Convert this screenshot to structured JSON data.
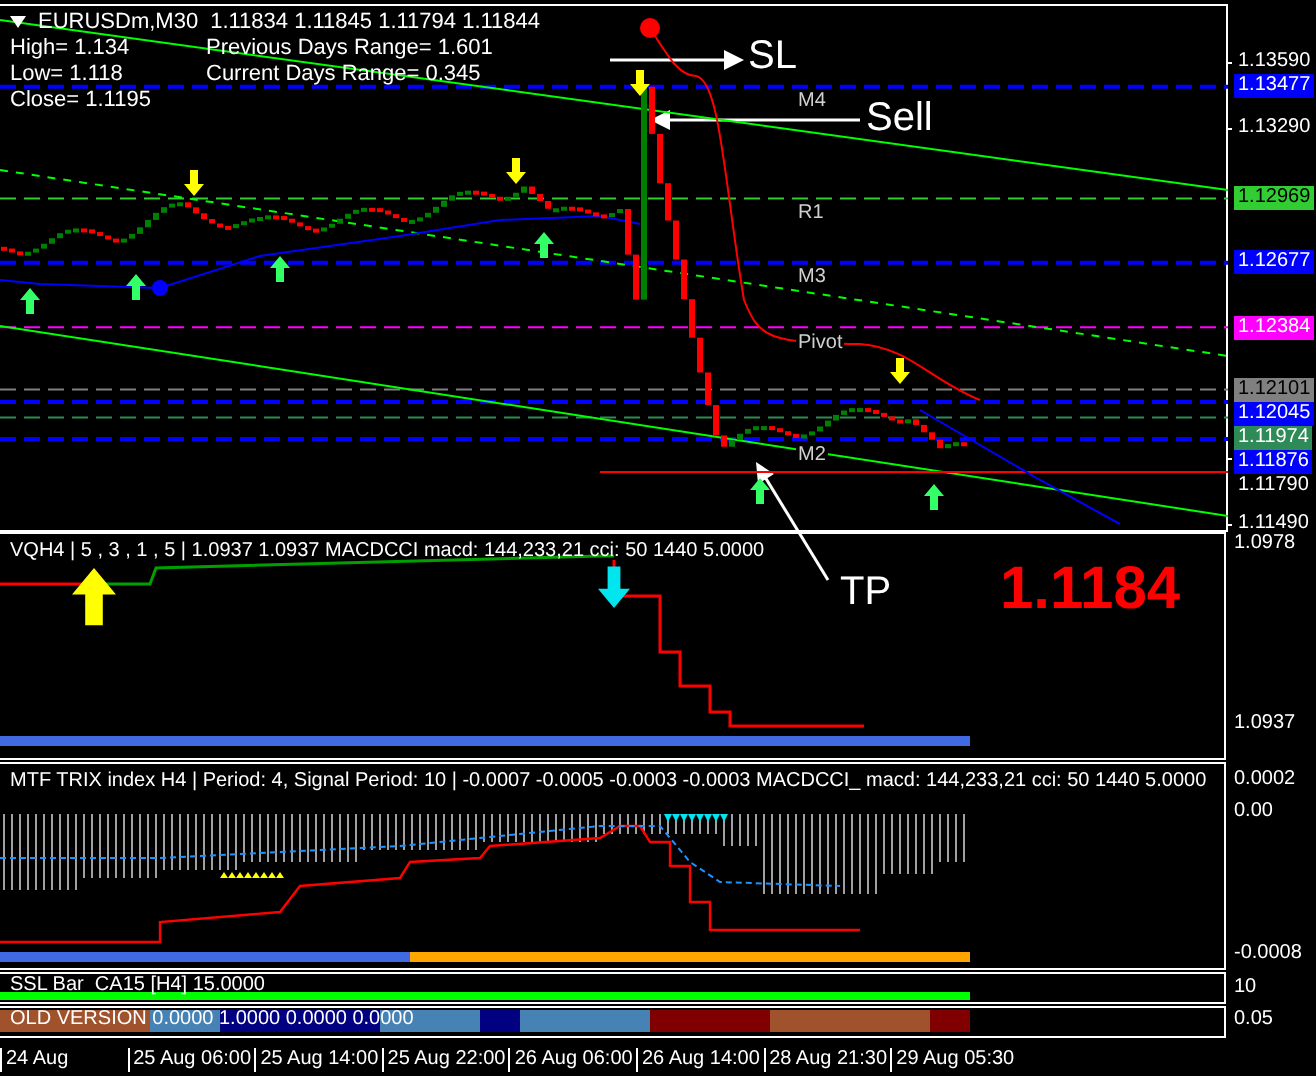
{
  "header": {
    "symbol": "EURUSDm,M30",
    "quotes": "1.11834 1.11845 1.11794 1.11844"
  },
  "stats": [
    [
      "High= 1.134",
      "Previous Days Range= 1.601"
    ],
    [
      "Low= 1.118",
      "Current Days Range= 0.345"
    ],
    [
      "Close= 1.1195"
    ]
  ],
  "price_axis": [
    {
      "kind": "tick",
      "text": "1.13590"
    },
    {
      "kind": "badge",
      "text": "1.13477",
      "color": "#0000ff",
      "level_label": "M4"
    },
    {
      "kind": "tick",
      "text": "1.13290"
    },
    {
      "kind": "badge",
      "text": "1.12969",
      "color": "#32cd32",
      "level_label": "R1"
    },
    {
      "kind": "badge",
      "text": "1.12677",
      "color": "#0000ff",
      "level_label": "M3"
    },
    {
      "kind": "badge",
      "text": "1.12384",
      "color": "#ff00ff",
      "level_label": "Pivot"
    },
    {
      "kind": "badge",
      "text": "1.12101",
      "color": "#808080"
    },
    {
      "kind": "badge",
      "text": "1.12045",
      "color": "#0000ff"
    },
    {
      "kind": "badge",
      "text": "1.11974",
      "color": "#2e8b57"
    },
    {
      "kind": "badge",
      "text": "1.11876",
      "color": "#0000ff",
      "level_label": "M2"
    },
    {
      "kind": "tick",
      "text": "1.11790"
    },
    {
      "kind": "tick",
      "text": "1.11490"
    }
  ],
  "annotations": [
    {
      "kind": "sl",
      "text": "SL"
    },
    {
      "kind": "sell",
      "text": "Sell"
    },
    {
      "kind": "tp",
      "text": "TP"
    }
  ],
  "big_price": "1.1184",
  "panels": [
    {
      "kind": "vq",
      "header": "VQH4 | 5 , 3 , 1 , 5 | 1.0937 1.0937 MACDCCI macd: 144,233,21 cci: 50 1440 5.0000",
      "axis": [
        "1.0978",
        "1.0937"
      ]
    },
    {
      "kind": "trix",
      "header": "MTF TRIX index H4 | Period: 4, Signal Period: 10 | -0.0007 -0.0005 -0.0003 -0.0003 MACDCCI_ macd: 144,233,21 cci: 50 1440 5.0000",
      "axis": [
        "0.0002",
        "0.00",
        "-0.0008"
      ]
    },
    {
      "kind": "ssl",
      "header": "SSL Bar  CA15 [H4] 15.0000",
      "axis": [
        "10"
      ]
    },
    {
      "kind": "old",
      "header": "OLD VERSION 0.0000 1.0000 0.0000 0.0000",
      "axis": [
        "0.05"
      ]
    }
  ],
  "time_axis": [
    "24 Aug",
    "25 Aug 06:00",
    "25 Aug 14:00",
    "25 Aug 22:00",
    "26 Aug 06:00",
    "26 Aug 14:00",
    "28 Aug 21:30",
    "29 Aug 05:30"
  ]
}
